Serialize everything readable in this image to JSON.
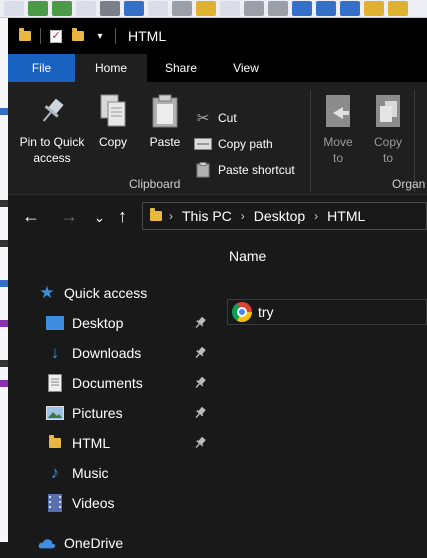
{
  "window": {
    "title": "HTML"
  },
  "tabs": {
    "file": "File",
    "home": "Home",
    "share": "Share",
    "view": "View"
  },
  "ribbon": {
    "pin_label_1": "Pin to Quick",
    "pin_label_2": "access",
    "copy": "Copy",
    "paste": "Paste",
    "cut": "Cut",
    "copy_path": "Copy path",
    "paste_shortcut": "Paste shortcut",
    "clipboard_group": "Clipboard",
    "move_to_1": "Move",
    "move_to_2": "to",
    "copy_to_1": "Copy",
    "copy_to_2": "to",
    "organize_group": "Organ"
  },
  "address": {
    "crumbs": [
      "This PC",
      "Desktop",
      "HTML"
    ]
  },
  "navpane": {
    "quick_access": "Quick access",
    "items": [
      {
        "label": "Desktop",
        "pinned": true
      },
      {
        "label": "Downloads",
        "pinned": true
      },
      {
        "label": "Documents",
        "pinned": true
      },
      {
        "label": "Pictures",
        "pinned": true
      },
      {
        "label": "HTML",
        "pinned": true
      },
      {
        "label": "Music",
        "pinned": false
      },
      {
        "label": "Videos",
        "pinned": false
      }
    ],
    "onedrive": "OneDrive"
  },
  "content": {
    "column_name": "Name",
    "files": [
      {
        "name": "try",
        "icon": "chrome-icon"
      }
    ]
  },
  "colors": {
    "file_tab": "#1a62c0",
    "folder": "#e8b840",
    "onedrive": "#3d8ee0"
  }
}
